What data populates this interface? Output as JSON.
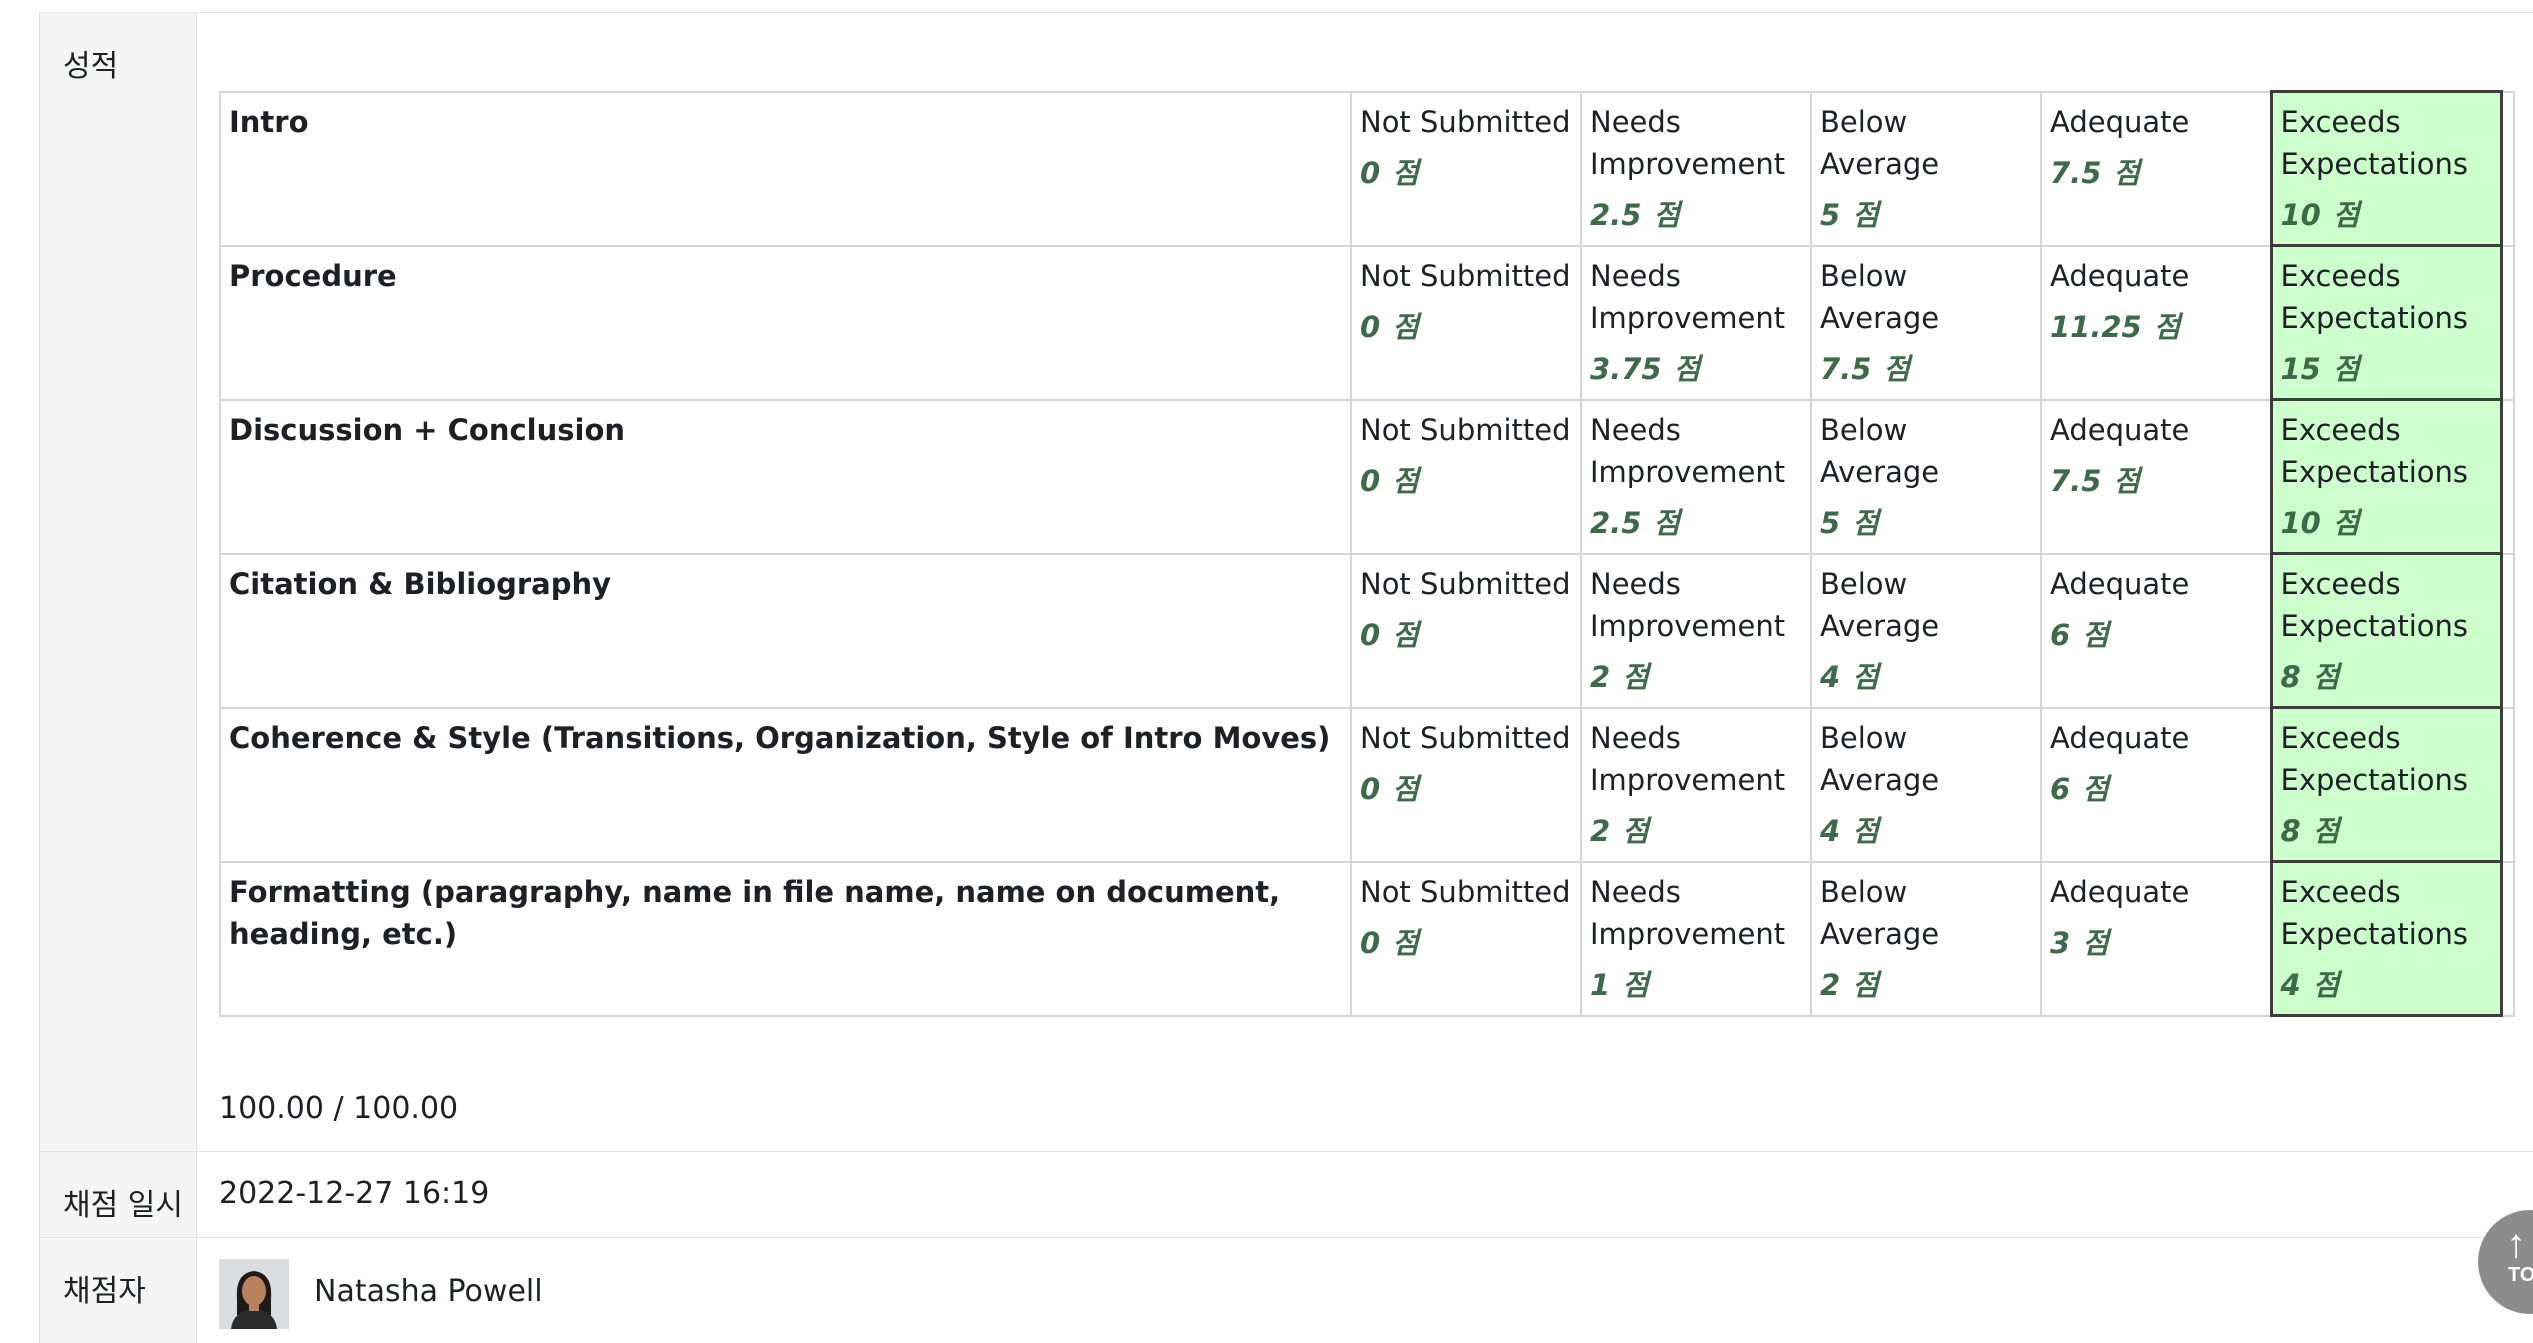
{
  "labels": {
    "grade": "성적",
    "graded_on": "채점 일시",
    "graded_by": "채점자"
  },
  "point_unit": "점",
  "rubric": [
    {
      "criterion": "Intro",
      "levels": [
        {
          "name": "Not Submitted",
          "points": "0"
        },
        {
          "name": "Needs Improvement",
          "points": "2.5"
        },
        {
          "name": "Below Average",
          "points": "5"
        },
        {
          "name": "Adequate",
          "points": "7.5"
        },
        {
          "name": "Exceeds Expectations",
          "points": "10"
        }
      ]
    },
    {
      "criterion": "Procedure",
      "levels": [
        {
          "name": "Not Submitted",
          "points": "0"
        },
        {
          "name": "Needs Improvement",
          "points": "3.75"
        },
        {
          "name": "Below Average",
          "points": "7.5"
        },
        {
          "name": "Adequate",
          "points": "11.25"
        },
        {
          "name": "Exceeds Expectations",
          "points": "15"
        }
      ]
    },
    {
      "criterion": "Discussion + Conclusion",
      "levels": [
        {
          "name": "Not Submitted",
          "points": "0"
        },
        {
          "name": "Needs Improvement",
          "points": "2.5"
        },
        {
          "name": "Below Average",
          "points": "5"
        },
        {
          "name": "Adequate",
          "points": "7.5"
        },
        {
          "name": "Exceeds Expectations",
          "points": "10"
        }
      ]
    },
    {
      "criterion": "Citation & Bibliography",
      "levels": [
        {
          "name": "Not Submitted",
          "points": "0"
        },
        {
          "name": "Needs Improvement",
          "points": "2"
        },
        {
          "name": "Below Average",
          "points": "4"
        },
        {
          "name": "Adequate",
          "points": "6"
        },
        {
          "name": "Exceeds Expectations",
          "points": "8"
        }
      ]
    },
    {
      "criterion": "Coherence & Style (Transitions, Organization, Style of Intro Moves)",
      "levels": [
        {
          "name": "Not Submitted",
          "points": "0"
        },
        {
          "name": "Needs Improvement",
          "points": "2"
        },
        {
          "name": "Below Average",
          "points": "4"
        },
        {
          "name": "Adequate",
          "points": "6"
        },
        {
          "name": "Exceeds Expectations",
          "points": "8"
        }
      ]
    },
    {
      "criterion": "Formatting (paragraphy, name in file name, name on document, heading, etc.)",
      "levels": [
        {
          "name": "Not Submitted",
          "points": "0"
        },
        {
          "name": "Needs Improvement",
          "points": "1"
        },
        {
          "name": "Below Average",
          "points": "2"
        },
        {
          "name": "Adequate",
          "points": "3"
        },
        {
          "name": "Exceeds Expectations",
          "points": "4"
        }
      ]
    }
  ],
  "selected_level": "Exceeds Expectations",
  "total_score": "100.00 / 100.00",
  "graded_date": "2022-12-27 16:19",
  "grader_name": "Natasha Powell",
  "to_top_label": "TO",
  "colors": {
    "selected_bg": "#ccffcc",
    "points_text": "#3d6b4a",
    "label_bg": "#f5f5f5"
  }
}
